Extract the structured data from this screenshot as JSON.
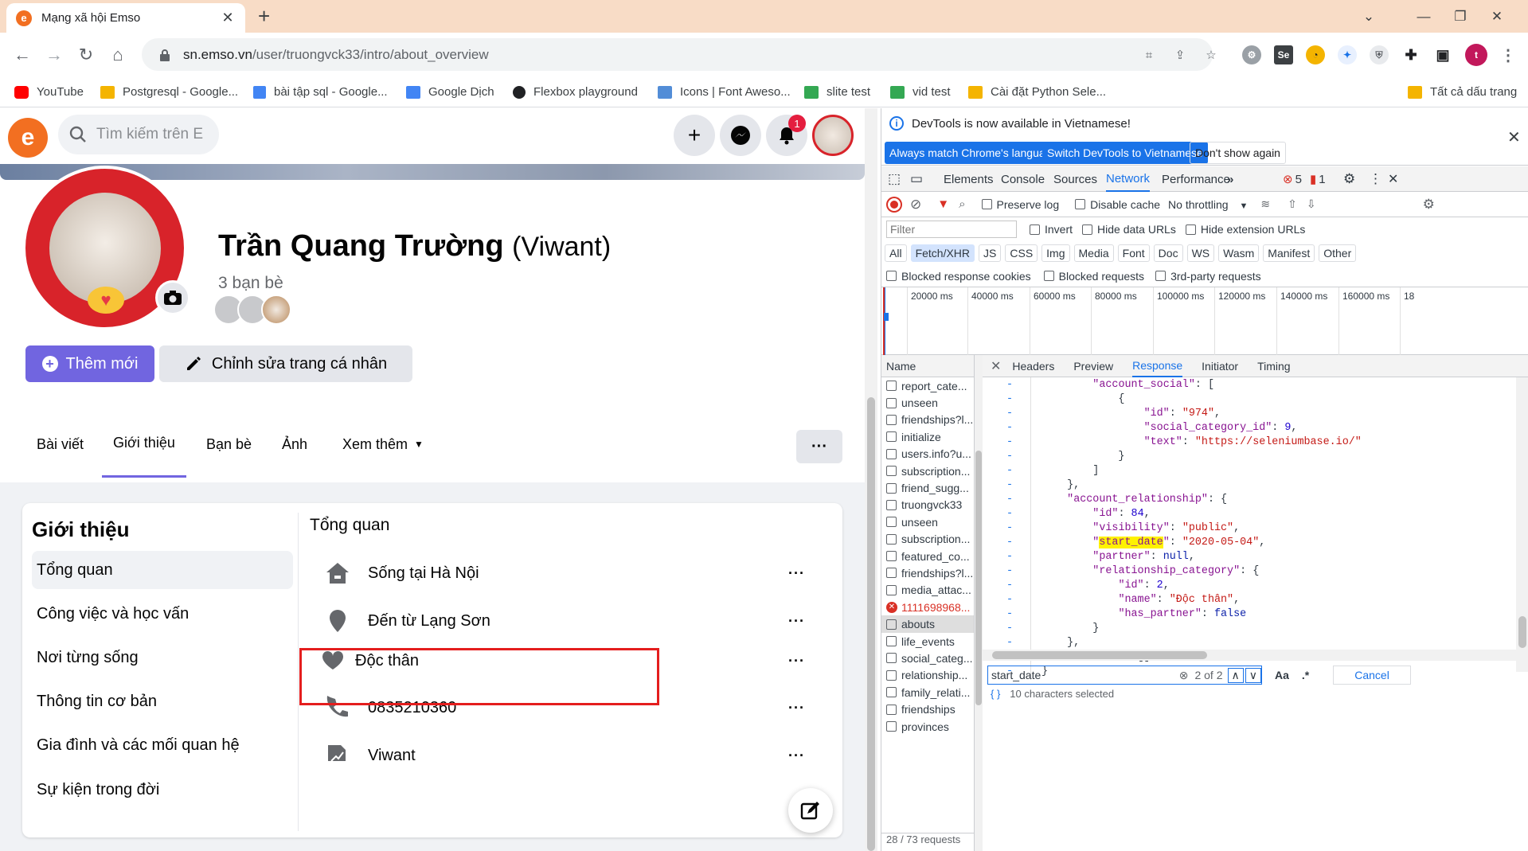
{
  "browser": {
    "tab_title": "Mạng xã hội Emso",
    "url_host": "sn.emso.vn",
    "url_path": "/user/truongvck33/intro/about_overview",
    "profile_initial": "t",
    "bookmarks": [
      {
        "label": "YouTube",
        "color": "#ff0000"
      },
      {
        "label": "Postgresql - Google...",
        "color": "#f4b400"
      },
      {
        "label": "bài tập sql - Google...",
        "color": "#4285f4"
      },
      {
        "label": "Google Dịch",
        "color": "#4285f4"
      },
      {
        "label": "Flexbox playground",
        "color": "#202124"
      },
      {
        "label": "Icons | Font Aweso...",
        "color": "#528dd7"
      },
      {
        "label": "slite test",
        "color": "#34a853"
      },
      {
        "label": "vid test",
        "color": "#34a853"
      },
      {
        "label": "Cài đặt Python Sele...",
        "color": "#f4b400"
      }
    ],
    "all_bookmarks": "Tất cả dấu trang"
  },
  "app": {
    "search_placeholder": "Tìm kiếm trên E",
    "notification_count": "1",
    "profile": {
      "name": "Trần Quang Trường",
      "nickname": "(Viwant)",
      "friends": "3 bạn bè"
    },
    "buttons": {
      "add_new": "Thêm mới",
      "edit_profile": "Chỉnh sửa trang cá nhân"
    },
    "tabs": [
      "Bài viết",
      "Giới thiệu",
      "Bạn bè",
      "Ảnh",
      "Xem thêm"
    ],
    "about": {
      "title": "Giới thiệu",
      "menu": [
        "Tổng quan",
        "Công việc và học vấn",
        "Nơi từng sống",
        "Thông tin cơ bản",
        "Gia đình và các mối quan hệ",
        "Sự kiện trong đời"
      ],
      "overview_title": "Tổng quan",
      "rows": [
        {
          "prefix": "Sống tại ",
          "value": "Hà Nội",
          "icon": "home-icon"
        },
        {
          "prefix": "Đến từ ",
          "value": "Lạng Sơn",
          "icon": "location-pin-icon"
        },
        {
          "prefix": "",
          "value": "Độc thân",
          "icon": "heart-icon"
        },
        {
          "prefix": "",
          "value": "0835210360",
          "icon": "phone-icon"
        },
        {
          "prefix": "",
          "value": "Viwant",
          "icon": "signature-icon"
        }
      ]
    }
  },
  "devtools": {
    "lang_msg": "DevTools is now available in Vietnamese!",
    "lang_buttons": [
      "Always match Chrome's language",
      "Switch DevTools to Vietnamese",
      "Don't show again"
    ],
    "tabs": [
      "Elements",
      "Console",
      "Sources",
      "Network",
      "Performance"
    ],
    "errors": "5",
    "warnings": "1",
    "toolbar": {
      "preserve_log": "Preserve log",
      "disable_cache": "Disable cache",
      "throttling": "No throttling"
    },
    "filter_placeholder": "Filter",
    "filter_opts": [
      "Invert",
      "Hide data URLs",
      "Hide extension URLs"
    ],
    "types": [
      "All",
      "Fetch/XHR",
      "JS",
      "CSS",
      "Img",
      "Media",
      "Font",
      "Doc",
      "WS",
      "Wasm",
      "Manifest",
      "Other"
    ],
    "block_opts": [
      "Blocked response cookies",
      "Blocked requests",
      "3rd-party requests"
    ],
    "ticks": [
      "20000 ms",
      "40000 ms",
      "60000 ms",
      "80000 ms",
      "100000 ms",
      "120000 ms",
      "140000 ms",
      "160000 ms",
      "18"
    ],
    "name_header": "Name",
    "requests": [
      "report_cate...",
      "unseen",
      "friendships?l...",
      "initialize",
      "users.info?u...",
      "subscription...",
      "friend_sugg...",
      "truongvck33",
      "unseen",
      "subscription...",
      "featured_co...",
      "friendships?l...",
      "media_attac...",
      "1111698968...",
      "abouts",
      "life_events",
      "social_categ...",
      "relationship...",
      "family_relati...",
      "friendships",
      "provinces"
    ],
    "detail_tabs": [
      "Headers",
      "Preview",
      "Response",
      "Initiator",
      "Timing"
    ],
    "find_value": "start_date",
    "find_count": "2 of 2",
    "find_case": "Aa",
    "find_regex": ".*",
    "cancel": "Cancel",
    "status_requests": "28 / 73 requests",
    "status_selected": "10 characters selected"
  }
}
